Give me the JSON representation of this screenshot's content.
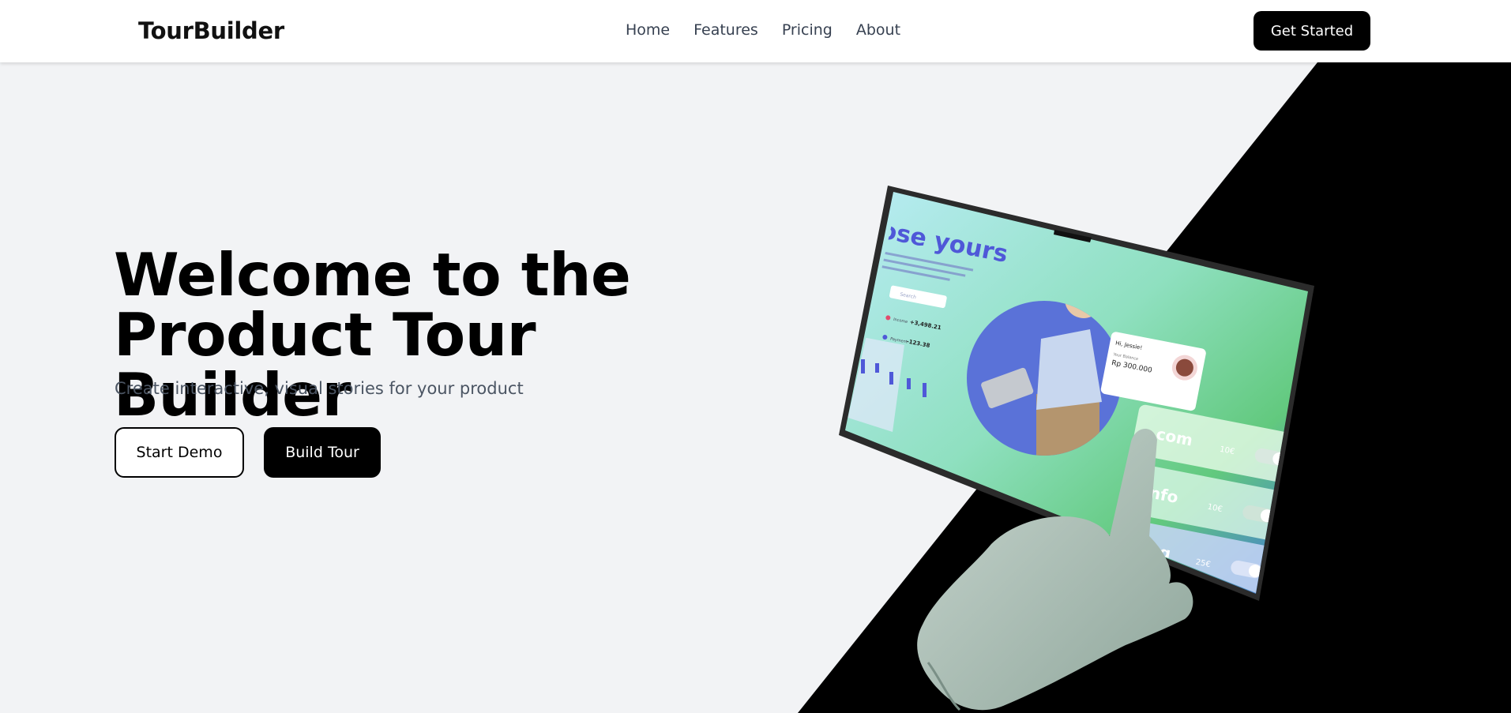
{
  "navbar": {
    "brand": "TourBuilder",
    "links": [
      {
        "label": "Home"
      },
      {
        "label": "Features"
      },
      {
        "label": "Pricing"
      },
      {
        "label": "About"
      }
    ],
    "cta_label": "Get Started"
  },
  "hero": {
    "title_line1": "Welcome to the",
    "title_line2": "Product Tour Builder",
    "subtitle": "Create interactive, visual stories for your product",
    "primary_button": "Start Demo",
    "secondary_button": "Build Tour"
  },
  "illustration": {
    "headline": "oose yours",
    "greeting": "Hi, Jessie!",
    "balance_label": "Your Balance",
    "balance_value": "Rp 300.000",
    "search_placeholder": "Search",
    "row1_label": "Income",
    "row1_value": "+3,498.21",
    "row2_label": "Payment",
    "row2_value": "-123.38",
    "domains": [
      {
        "name": ".com",
        "price": "10€"
      },
      {
        "name": ".info",
        "price": "10€"
      },
      {
        "name": ".blog",
        "price": "25€"
      }
    ]
  },
  "colors": {
    "background": "#f2f3f5",
    "black_panel": "#000000",
    "accent_blue": "#5b6fd6",
    "accent_green": "#6ccf7a"
  }
}
